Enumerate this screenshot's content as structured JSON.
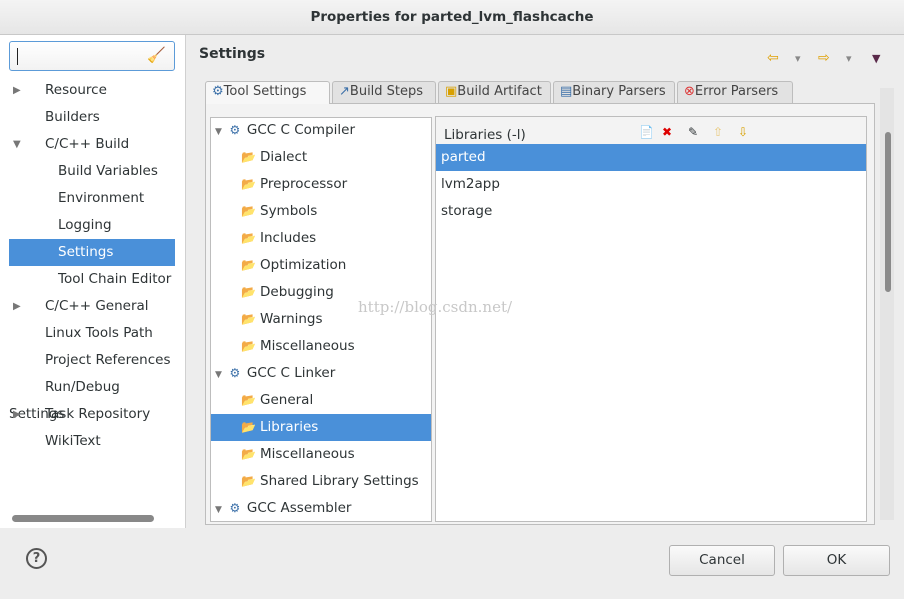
{
  "window": {
    "title": "Properties for parted_lvm_flashcache"
  },
  "search": {
    "value": ""
  },
  "nav": [
    {
      "label": "Resource",
      "expander": "collapsed",
      "indent": 0
    },
    {
      "label": "Builders",
      "expander": "none",
      "indent": 0
    },
    {
      "label": "C/C++ Build",
      "expander": "expanded",
      "indent": 0
    },
    {
      "label": "Build Variables",
      "expander": "none",
      "indent": 1
    },
    {
      "label": "Environment",
      "expander": "none",
      "indent": 1
    },
    {
      "label": "Logging",
      "expander": "none",
      "indent": 1
    },
    {
      "label": "Settings",
      "expander": "none",
      "indent": 1,
      "selected": true
    },
    {
      "label": "Tool Chain Editor",
      "expander": "none",
      "indent": 1
    },
    {
      "label": "C/C++ General",
      "expander": "collapsed",
      "indent": 0
    },
    {
      "label": "Linux Tools Path",
      "expander": "none",
      "indent": 0
    },
    {
      "label": "Project References",
      "expander": "none",
      "indent": 0
    },
    {
      "label": "Run/Debug Settings",
      "expander": "none",
      "indent": 0
    },
    {
      "label": "Task Repository",
      "expander": "collapsed",
      "indent": 0
    },
    {
      "label": "WikiText",
      "expander": "none",
      "indent": 0
    }
  ],
  "page": {
    "title": "Settings"
  },
  "tabs": [
    {
      "label": "Tool Settings",
      "icon": "tool-icon",
      "active": true
    },
    {
      "label": "Build Steps",
      "icon": "build-steps-icon"
    },
    {
      "label": "Build Artifact",
      "icon": "artifact-icon"
    },
    {
      "label": "Binary Parsers",
      "icon": "binary-icon"
    },
    {
      "label": "Error Parsers",
      "icon": "error-icon"
    }
  ],
  "tree": [
    {
      "label": "GCC C Compiler",
      "type": "tool"
    },
    {
      "label": "Dialect",
      "type": "option"
    },
    {
      "label": "Preprocessor",
      "type": "option"
    },
    {
      "label": "Symbols",
      "type": "option"
    },
    {
      "label": "Includes",
      "type": "option"
    },
    {
      "label": "Optimization",
      "type": "option"
    },
    {
      "label": "Debugging",
      "type": "option"
    },
    {
      "label": "Warnings",
      "type": "option"
    },
    {
      "label": "Miscellaneous",
      "type": "option"
    },
    {
      "label": "GCC C Linker",
      "type": "tool"
    },
    {
      "label": "General",
      "type": "option"
    },
    {
      "label": "Libraries",
      "type": "option",
      "selected": true
    },
    {
      "label": "Miscellaneous",
      "type": "option"
    },
    {
      "label": "Shared Library Settings",
      "type": "option"
    },
    {
      "label": "GCC Assembler",
      "type": "tool"
    }
  ],
  "libraries": {
    "label": "Libraries (-l)",
    "items": [
      "parted",
      "lvm2app",
      "storage"
    ]
  },
  "watermark": "http://blog.csdn.net/",
  "buttons": {
    "cancel": "Cancel",
    "ok": "OK"
  },
  "colors": {
    "selection": "#4a90d9"
  }
}
